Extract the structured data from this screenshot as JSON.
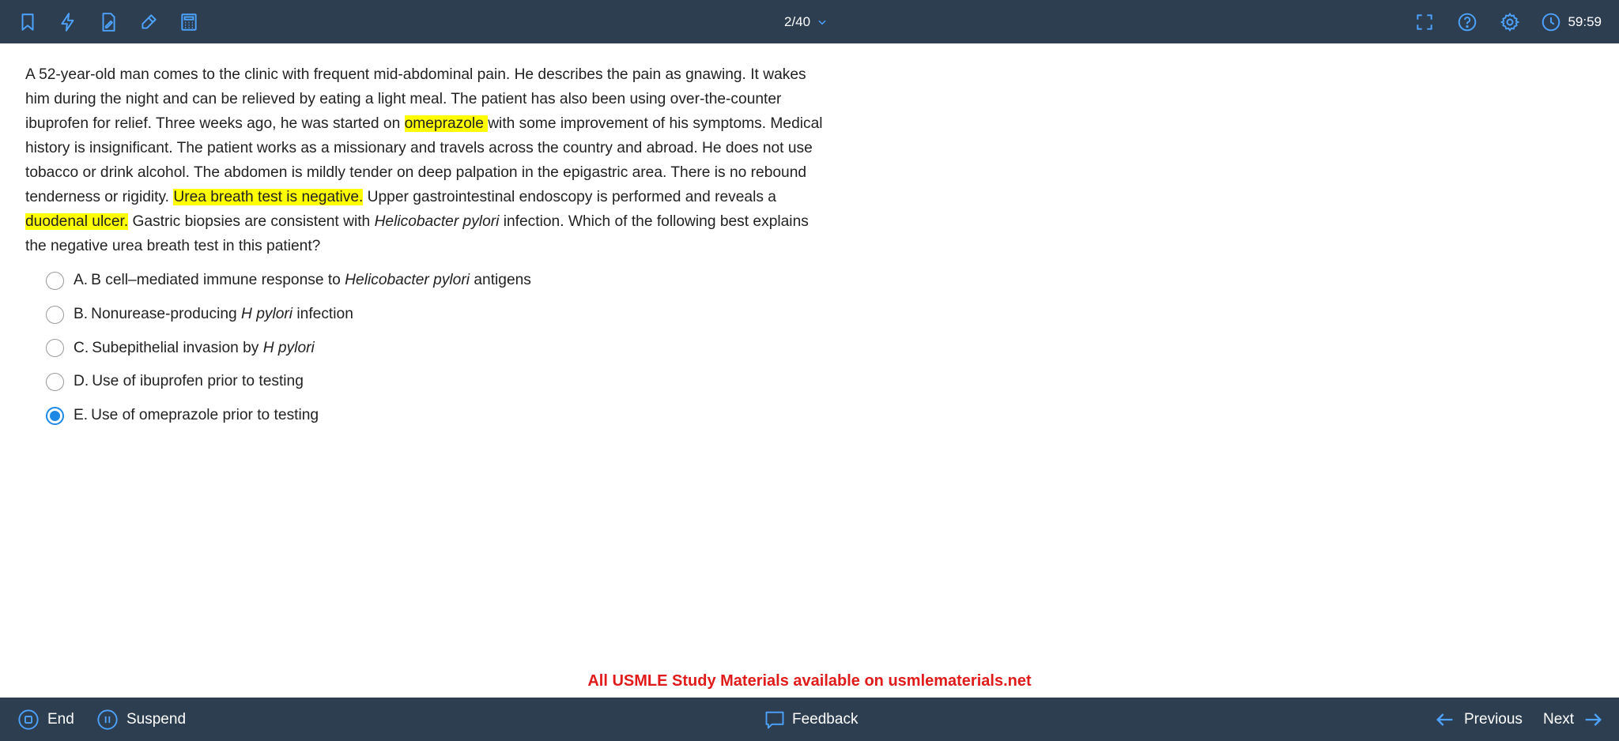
{
  "topbar": {
    "icons": [
      "bookmark-icon",
      "lightning-icon",
      "notes-icon",
      "highlighter-icon",
      "calculator-icon"
    ],
    "question_counter": "2/40",
    "right_icons": [
      "fullscreen-icon",
      "help-icon",
      "settings-icon"
    ],
    "timer": "59:59",
    "icon_color": "#4da3ff",
    "bar_color": "#2c3e50"
  },
  "question": {
    "p1": "A 52-year-old man comes to the clinic with frequent mid-abdominal pain.  He describes the pain as gnawing.  It wakes him during the night and can be relieved by eating a light meal.  The patient has also been using over-the-counter ibuprofen for relief.  Three weeks ago, he was started on ",
    "h1": "omeprazole ",
    "p2": "with some improvement of his symptoms.  Medical history is insignificant.  The patient works as a missionary and travels across the country and abroad.  He does not use tobacco or drink alcohol.  The abdomen is mildly tender on deep palpation in the epigastric area.  There is no rebound tenderness or rigidity.  ",
    "h2": "Urea breath test is negative.",
    "p3": "  Upper gastrointestinal endoscopy is performed and reveals a ",
    "h3": "duodenal ulcer.",
    "p4": "  Gastric biopsies are consistent with ",
    "i1": "Helicobacter pylori",
    "p5": " infection.  Which of the following best explains the negative urea breath test in this patient?",
    "highlight_color": "#ffff00"
  },
  "answers": [
    {
      "letter": "A.",
      "before": "B cell–mediated immune response to ",
      "italic": "Helicobacter pylori",
      "after": " antigens",
      "selected": false
    },
    {
      "letter": "B.",
      "before": "Nonurease-producing ",
      "italic": "H pylori",
      "after": " infection",
      "selected": false
    },
    {
      "letter": "C.",
      "before": "Subepithelial invasion by ",
      "italic": "H pylori",
      "after": "",
      "selected": false
    },
    {
      "letter": "D.",
      "before": "Use of ibuprofen prior to testing",
      "italic": "",
      "after": "",
      "selected": false
    },
    {
      "letter": "E.",
      "before": "Use of omeprazole prior to testing",
      "italic": "",
      "after": "",
      "selected": true
    }
  ],
  "promo": "All USMLE Study Materials available on usmlematerials.net",
  "bottombar": {
    "end_label": "End",
    "suspend_label": "Suspend",
    "feedback_label": "Feedback",
    "previous_label": "Previous",
    "next_label": "Next"
  },
  "colors": {
    "selected_radio": "#1e88e5",
    "promo_text": "#e01b1b"
  }
}
